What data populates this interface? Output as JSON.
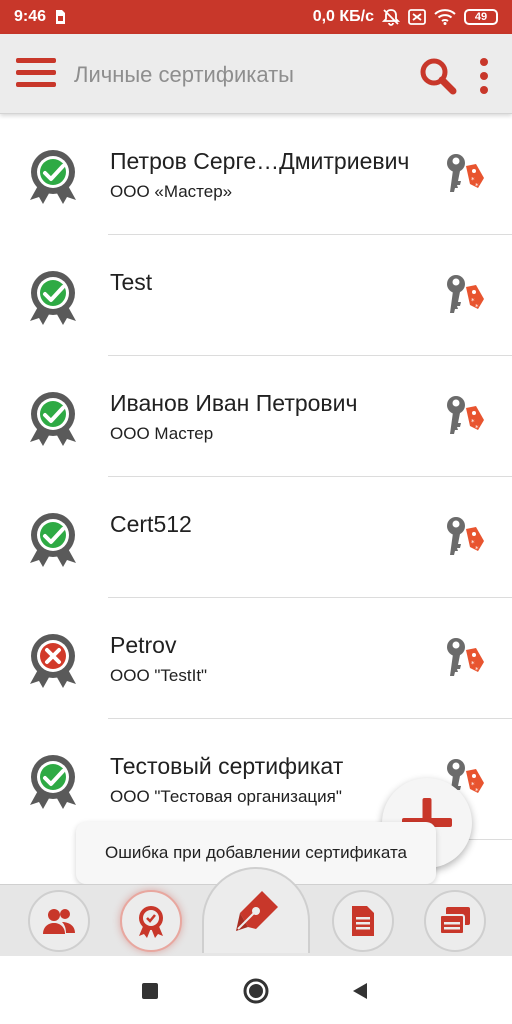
{
  "status_bar": {
    "time": "9:46",
    "network_speed": "0,0 КБ/с",
    "battery": "49"
  },
  "app_bar": {
    "title": "Личные сертификаты"
  },
  "certificates": [
    {
      "name": "Петров Серге…Дмитриевич",
      "org": "ООО «Мастер»",
      "status": "valid"
    },
    {
      "name": "Test",
      "org": "",
      "status": "valid"
    },
    {
      "name": "Иванов Иван Петрович",
      "org": "ООО Мастер",
      "status": "valid"
    },
    {
      "name": "Cert512",
      "org": "",
      "status": "valid"
    },
    {
      "name": "Petrov",
      "org": "ООО \"TestIt\"",
      "status": "invalid"
    },
    {
      "name": "Тестовый сертификат",
      "org": "ООО \"Тестовая организация\"",
      "status": "valid"
    }
  ],
  "toast": {
    "message": "Ошибка при добавлении сертификата"
  },
  "colors": {
    "accent": "#c8372a",
    "valid": "#2eaa44",
    "invalid": "#d23a2a",
    "ribbon": "#5a5a5a"
  }
}
